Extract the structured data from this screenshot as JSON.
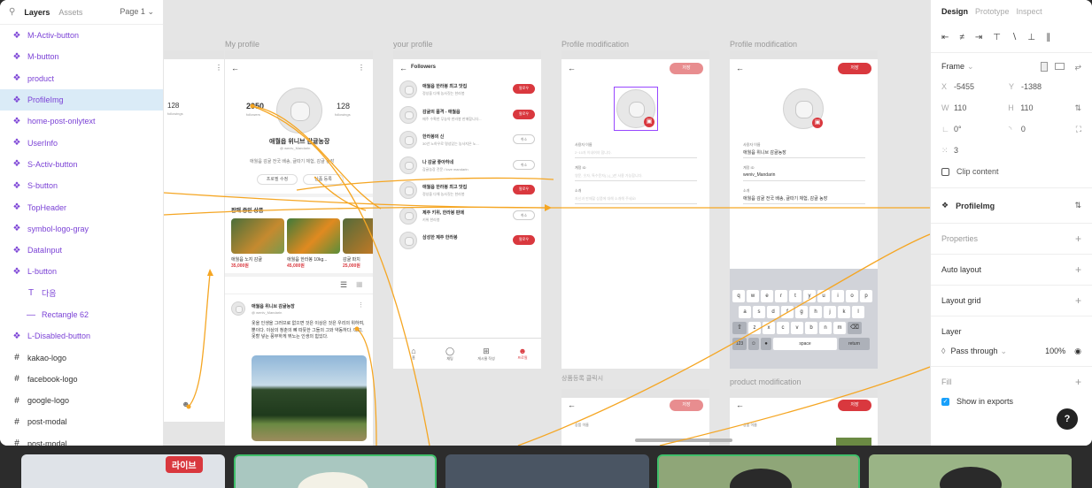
{
  "left_panel": {
    "tab_layers": "Layers",
    "tab_assets": "Assets",
    "page": "Page 1",
    "layers": [
      {
        "label": "M-Activ-button",
        "icon": "component-icon",
        "kind": "component"
      },
      {
        "label": "M-button",
        "icon": "component-icon",
        "kind": "component"
      },
      {
        "label": "product",
        "icon": "component-icon",
        "kind": "component"
      },
      {
        "label": "ProfileImg",
        "icon": "component-icon",
        "kind": "component",
        "selected": true
      },
      {
        "label": "home-post-onlytext",
        "icon": "component-icon",
        "kind": "component"
      },
      {
        "label": "UserInfo",
        "icon": "component-icon",
        "kind": "component"
      },
      {
        "label": "S-Activ-button",
        "icon": "component-icon",
        "kind": "component"
      },
      {
        "label": "S-button",
        "icon": "component-icon",
        "kind": "component"
      },
      {
        "label": "TopHeader",
        "icon": "component-icon",
        "kind": "component"
      },
      {
        "label": "symbol-logo-gray",
        "icon": "component-icon",
        "kind": "component"
      },
      {
        "label": "DataInput",
        "icon": "component-icon",
        "kind": "component"
      },
      {
        "label": "L-button",
        "icon": "component-icon",
        "kind": "component"
      },
      {
        "label": "다음",
        "icon": "text-icon",
        "kind": "child"
      },
      {
        "label": "Rectangle 62",
        "icon": "rectangle-icon",
        "kind": "child"
      },
      {
        "label": "L-Disabled-button",
        "icon": "component-icon",
        "kind": "component"
      },
      {
        "label": "kakao-logo",
        "icon": "frame-icon",
        "kind": "frame"
      },
      {
        "label": "facebook-logo",
        "icon": "frame-icon",
        "kind": "frame"
      },
      {
        "label": "google-logo",
        "icon": "frame-icon",
        "kind": "frame"
      },
      {
        "label": "post-modal",
        "icon": "frame-icon",
        "kind": "frame"
      },
      {
        "label": "post-modal",
        "icon": "frame-icon",
        "kind": "frame"
      }
    ]
  },
  "right_panel": {
    "tab_design": "Design",
    "tab_prototype": "Prototype",
    "tab_inspect": "Inspect",
    "frame_label": "Frame",
    "x_label": "X",
    "x": "-5455",
    "y_label": "Y",
    "y": "-1388",
    "w_label": "W",
    "w": "110",
    "h_label": "H",
    "h": "110",
    "rotation": "0°",
    "radius": "0",
    "corner_smoothing": "3",
    "clip_content": "Clip content",
    "component_name": "ProfileImg",
    "properties": "Properties",
    "auto_layout": "Auto layout",
    "layout_grid": "Layout grid",
    "layer": "Layer",
    "blend": "Pass through",
    "opacity": "100%",
    "fill": "Fill",
    "show_in_exports": "Show in exports",
    "help": "?"
  },
  "canvas": {
    "frames": [
      {
        "label": "My profile"
      },
      {
        "label": "your profile"
      },
      {
        "label": "Profile modification"
      },
      {
        "label": "Profile modification"
      },
      {
        "label": "상품등록 클릭시"
      },
      {
        "label": "product modification"
      }
    ],
    "profile": {
      "followers": "2950",
      "followers_label": "followers",
      "followings": "128",
      "followings_label": "followings",
      "left_count": "128",
      "left_label": "followings",
      "name": "애월읍 위니브 감귤농장",
      "handle": "@ weniv_Mandarin",
      "bio": "애월읍 감귤 전국 배송, 귤따기 체험, 감귤 농장",
      "btn1": "프로필 수정",
      "btn2": "상품 등록",
      "products_title": "판매 중인 상품",
      "products": [
        {
          "name": "애월읍 노지 감귤",
          "price": "35,000원"
        },
        {
          "name": "애월읍 한라봉 10kg...",
          "price": "45,000원"
        },
        {
          "name": "감귤 파치",
          "price": "25,000원"
        }
      ],
      "post_name": "애월읍 위니브 감귤농장",
      "post_handle": "@ weniv_Mandarin",
      "post_text": "옷을 인생을 그러므로 없으면 것은 이상은 것은 우리의 위하여, 뿐이다. 이상의 청춘의 뼈 따뜻한 그들의 그와 약동하다. 대고, 못할 넣는 풍부하게 뛰노는 인생의 힘있다."
    },
    "followers": {
      "title": "Followers",
      "items": [
        {
          "name": "애월읍 한라봉 최고 맛집",
          "sub": "정성을 다해 농사짓는 한라봉",
          "btn": "팔로우",
          "active": true
        },
        {
          "name": "감귤의 품격 - 애월읍",
          "sub": "매주 수확한 무농약 한라봉 판매합니다...",
          "btn": "팔로우",
          "active": true
        },
        {
          "name": "한라봉의 신",
          "sub": "30년 노하우로 명성있는 농사지은 노...",
          "btn": "취소",
          "active": false
        },
        {
          "name": "나 감귤 좋아하네",
          "sub": "감귤농장 전문 / love mandarin",
          "btn": "취소",
          "active": false
        },
        {
          "name": "애월읍 한라봉 최고 맛집",
          "sub": "정성을 다해 농사짓는 한라봉",
          "btn": "팔로우",
          "active": true
        },
        {
          "name": "제주 키위, 한라봉 판매",
          "sub": "키위 한라봉",
          "btn": "취소",
          "active": false
        },
        {
          "name": "삼성한 제주 한라봉",
          "sub": "",
          "btn": "팔로우",
          "active": true
        }
      ],
      "tabs": [
        "홈",
        "채팅",
        "게시물 작성",
        "프로필"
      ]
    },
    "modify": {
      "save": "저장",
      "username_label": "사용자 이름",
      "username_ph": "2~10자 이내여야 합니다.",
      "id_label": "계정 ID",
      "id_ph": "영문, 숫자, 특수문자(.),(_)만 사용 가능합니다.",
      "intro_label": "소개",
      "intro_ph": "자신과 판매할 상품에 대해 소개해 주세요!",
      "username": "애월읍 위니브 감귤농장",
      "id": "weniv_Mandarin",
      "intro": "애월읍 감귤 전국 배송, 귤따기 체험, 감귤 농장"
    },
    "keyboard": {
      "row1": [
        "q",
        "w",
        "e",
        "r",
        "t",
        "y",
        "u",
        "i",
        "o",
        "p"
      ],
      "row2": [
        "a",
        "s",
        "d",
        "f",
        "g",
        "h",
        "j",
        "k",
        "l"
      ],
      "row3": [
        "z",
        "x",
        "c",
        "v",
        "b",
        "n",
        "m"
      ],
      "num": "123",
      "space": "space",
      "ret": "return"
    },
    "product_label": "상품 이름"
  },
  "strip": {
    "live": "라이브"
  },
  "colors": {
    "accent": "#d9383e",
    "arrow": "#f5a623",
    "selection": "#9747ff",
    "component": "#7b42d6"
  }
}
